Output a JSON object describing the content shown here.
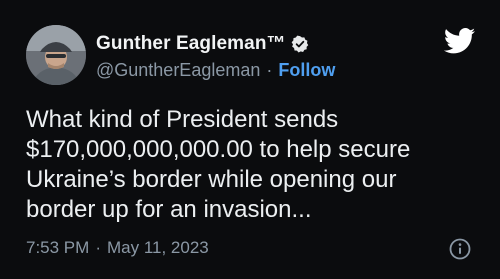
{
  "tweet": {
    "display_name": "Gunther Eagleman™",
    "handle": "@GuntherEagleman",
    "separator": "·",
    "follow_label": "Follow",
    "text": "What kind of President sends\n$170,000,000,000.00 to help secure\nUkraine’s border while opening our\nborder up for an invasion...",
    "time": "7:53 PM",
    "date": "May 11, 2023"
  },
  "icons": {
    "verified": "verified-badge-icon",
    "brand": "twitter-bird-icon",
    "info": "info-icon"
  },
  "colors": {
    "background": "#0b0c0e",
    "text": "#eceff1",
    "muted": "#8b98a5",
    "accent": "#4f9ff0"
  }
}
